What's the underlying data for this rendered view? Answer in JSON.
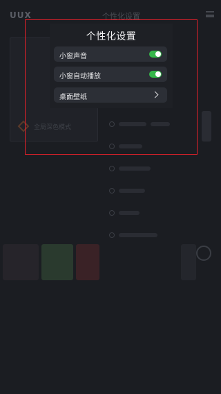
{
  "background_app": {
    "brand": "UUX",
    "header_title": "个性化设置",
    "thumbnail_caption": "全局深色模式"
  },
  "popup": {
    "title": "个性化设置",
    "items": [
      {
        "label": "小窗声音",
        "control": "toggle",
        "on": true
      },
      {
        "label": "小窗自动播放",
        "control": "toggle",
        "on": true
      },
      {
        "label": "桌面壁纸",
        "control": "chevron"
      }
    ]
  },
  "colors": {
    "background": "#1b1d22",
    "row_background": "#2c2f36",
    "toggle_on": "#35b64a",
    "highlight_border": "#e0202a"
  },
  "icons": [
    "menu-icon",
    "chevron-right-icon"
  ]
}
